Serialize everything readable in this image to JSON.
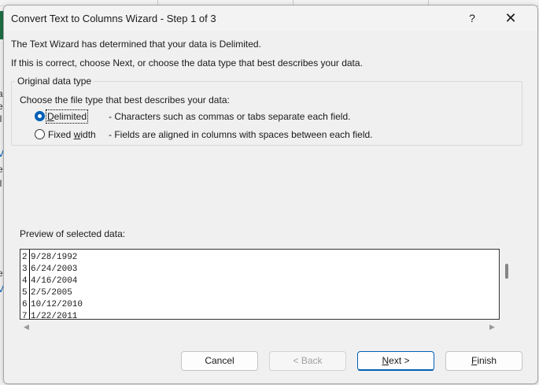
{
  "dialog": {
    "title": "Convert Text to Columns Wizard - Step 1 of 3",
    "help_label": "?",
    "close_label": "✕"
  },
  "intro": {
    "line1": "The Text Wizard has determined that your data is Delimited.",
    "line2": "If this is correct, choose Next, or choose the data type that best describes your data."
  },
  "original_data_type": {
    "legend": "Original data type",
    "prompt": "Choose the file type that best describes your data:",
    "options": [
      {
        "label_pre": "",
        "label_key": "D",
        "label_post": "elimited",
        "description": "- Characters such as commas or tabs separate each field.",
        "selected": true
      },
      {
        "label_pre": "Fixed ",
        "label_key": "w",
        "label_post": "idth",
        "description": "- Fields are aligned in columns with spaces between each field.",
        "selected": false
      }
    ]
  },
  "preview": {
    "label": "Preview of selected data:",
    "rows": [
      {
        "num": "2",
        "value": "9/28/1992"
      },
      {
        "num": "3",
        "value": "6/24/2003"
      },
      {
        "num": "4",
        "value": "4/16/2004"
      },
      {
        "num": "5",
        "value": "2/5/2005"
      },
      {
        "num": "6",
        "value": "10/12/2010"
      },
      {
        "num": "7",
        "value": "1/22/2011"
      }
    ],
    "scroll_left_glyph": "◀",
    "scroll_right_glyph": "▶"
  },
  "buttons": {
    "cancel": "Cancel",
    "back": "< Back",
    "next_key": "N",
    "next_rest": "ext >",
    "finish_key": "F",
    "finish_rest": "inish"
  },
  "background": {
    "fragments": [
      "a",
      "e",
      "il",
      "V",
      "e",
      "il",
      "e",
      "V"
    ]
  },
  "colors": {
    "accent": "#005fb8",
    "dialog_bg": "#f0f0f0",
    "excel_green": "#1e7145"
  }
}
